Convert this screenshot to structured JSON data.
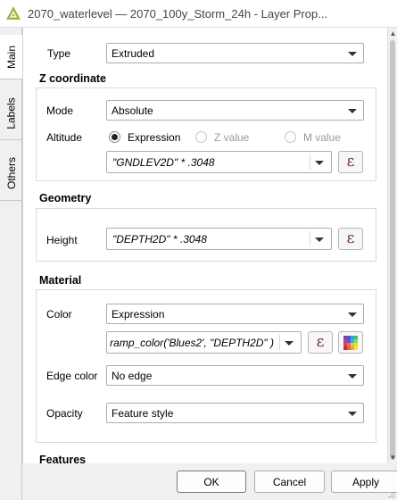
{
  "window": {
    "title": "2070_waterlevel — 2070_100y_Storm_24h - Layer Prop..."
  },
  "side_tabs": [
    {
      "label": "Main"
    },
    {
      "label": "Labels"
    },
    {
      "label": "Others"
    }
  ],
  "type_row": {
    "label": "Type",
    "value": "Extruded"
  },
  "z_coordinate": {
    "title": "Z coordinate",
    "mode_label": "Mode",
    "mode_value": "Absolute",
    "altitude_label": "Altitude",
    "radios": [
      {
        "label": "Expression",
        "checked": true
      },
      {
        "label": "Z value",
        "checked": false
      },
      {
        "label": "M value",
        "checked": false
      }
    ],
    "expression": "\"GNDLEV2D\"  * .3048"
  },
  "geometry": {
    "title": "Geometry",
    "height_label": "Height",
    "height_expression": "\"DEPTH2D\" * .3048"
  },
  "material": {
    "title": "Material",
    "color_label": "Color",
    "color_mode": "Expression",
    "color_expression": "ramp_color('Blues2',  \"DEPTH2D\" )",
    "edge_color_label": "Edge color",
    "edge_color_value": "No edge",
    "opacity_label": "Opacity",
    "opacity_value": "Feature style"
  },
  "features": {
    "title": "Features"
  },
  "buttons": {
    "ok": "OK",
    "cancel": "Cancel",
    "apply": "Apply"
  },
  "icons": {
    "app_logo": "qgis-logo",
    "expression_button": "epsilon-icon",
    "color_ramp_button": "color-ramp-icon",
    "dropdown": "chevron-down-icon"
  },
  "colors": {
    "expression_epsilon": "#6d2a60",
    "logo": "#8fbf3c"
  }
}
